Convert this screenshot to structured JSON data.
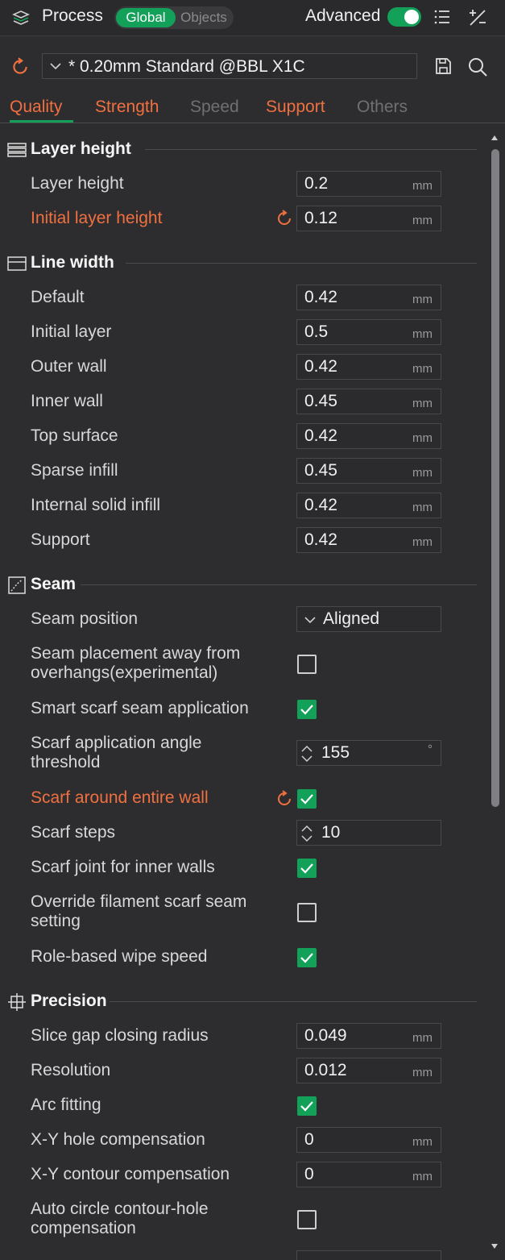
{
  "header": {
    "title": "Process",
    "mode_global": "Global",
    "mode_objects": "Objects",
    "advanced_label": "Advanced",
    "advanced_on": true
  },
  "preset": {
    "name": "* 0.20mm Standard @BBL X1C"
  },
  "tabs": [
    {
      "label": "Quality",
      "state": "active"
    },
    {
      "label": "Strength",
      "state": "normal"
    },
    {
      "label": "Speed",
      "state": "disabled"
    },
    {
      "label": "Support",
      "state": "normal"
    },
    {
      "label": "Others",
      "state": "disabled"
    }
  ],
  "sections": {
    "layer_height": {
      "title": "Layer height",
      "rows": [
        {
          "label": "Layer height",
          "value": "0.2",
          "unit": "mm"
        },
        {
          "label": "Initial layer height",
          "value": "0.12",
          "unit": "mm",
          "modified": true
        }
      ]
    },
    "line_width": {
      "title": "Line width",
      "rows": [
        {
          "label": "Default",
          "value": "0.42",
          "unit": "mm"
        },
        {
          "label": "Initial layer",
          "value": "0.5",
          "unit": "mm"
        },
        {
          "label": "Outer wall",
          "value": "0.42",
          "unit": "mm"
        },
        {
          "label": "Inner wall",
          "value": "0.45",
          "unit": "mm"
        },
        {
          "label": "Top surface",
          "value": "0.42",
          "unit": "mm"
        },
        {
          "label": "Sparse infill",
          "value": "0.45",
          "unit": "mm"
        },
        {
          "label": "Internal solid infill",
          "value": "0.42",
          "unit": "mm"
        },
        {
          "label": "Support",
          "value": "0.42",
          "unit": "mm"
        }
      ]
    },
    "seam": {
      "title": "Seam",
      "seam_position": {
        "label": "Seam position",
        "value": "Aligned"
      },
      "away_overhangs": {
        "label_line1": "Seam placement away from",
        "label_line2": "overhangs(experimental)",
        "checked": false
      },
      "smart_scarf": {
        "label": "Smart scarf seam application",
        "checked": true
      },
      "scarf_angle": {
        "label_line1": "Scarf application angle",
        "label_line2": "threshold",
        "value": "155",
        "unit": "°"
      },
      "scarf_entire_wall": {
        "label": "Scarf around entire wall",
        "checked": true,
        "modified": true
      },
      "scarf_steps": {
        "label": "Scarf steps",
        "value": "10"
      },
      "scarf_inner_walls": {
        "label": "Scarf joint for inner walls",
        "checked": true
      },
      "override_filament": {
        "label_line1": "Override filament scarf seam",
        "label_line2": "setting",
        "checked": false
      },
      "role_wipe": {
        "label": "Role-based wipe speed",
        "checked": true
      }
    },
    "precision": {
      "title": "Precision",
      "slice_gap": {
        "label": "Slice gap closing radius",
        "value": "0.049",
        "unit": "mm"
      },
      "resolution": {
        "label": "Resolution",
        "value": "0.012",
        "unit": "mm"
      },
      "arc_fitting": {
        "label": "Arc fitting",
        "checked": true
      },
      "xy_hole": {
        "label": "X-Y hole compensation",
        "value": "0",
        "unit": "mm"
      },
      "xy_contour": {
        "label": "X-Y contour compensation",
        "value": "0",
        "unit": "mm"
      },
      "auto_circle": {
        "label_line1": "Auto circle contour-hole",
        "label_line2": "compensation",
        "checked": false
      }
    }
  },
  "colors": {
    "accent": "#13a15a",
    "modified": "#f07040",
    "bg": "#2d2d30"
  }
}
